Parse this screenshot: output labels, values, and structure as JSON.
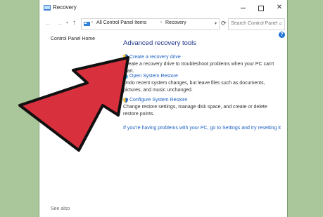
{
  "window": {
    "title": "Recovery",
    "min_label": "",
    "close_label": "✕"
  },
  "address_bar": {
    "crumbs": [
      "All Control Panel Items",
      "Recovery"
    ],
    "separator": "›"
  },
  "search": {
    "placeholder": "Search Control Panel"
  },
  "sidebar": {
    "home_link": "Control Panel Home",
    "see_also": "See also"
  },
  "main": {
    "heading": "Advanced recovery tools",
    "tasks": [
      {
        "label": "Create a recovery drive",
        "description": "Create a recovery drive to troubleshoot problems when your PC can't start."
      },
      {
        "label": "Open System Restore",
        "description": "Undo recent system changes, but leave files such as documents, pictures, and music unchanged."
      },
      {
        "label": "Configure System Restore",
        "description": "Change restore settings, manage disk space, and create or delete restore points."
      }
    ],
    "reset_link": "If you're having problems with your PC, go to Settings and try resetting it"
  },
  "colors": {
    "background": "#a9c79a",
    "link": "#1a5fc0",
    "heading": "#1e3287",
    "arrow": "#d9303e"
  },
  "icons": [
    "recovery-window-icon",
    "back-arrow-icon",
    "forward-arrow-icon",
    "up-arrow-icon",
    "control-panel-icon",
    "refresh-icon",
    "search-icon",
    "help-icon",
    "shield-icon",
    "pointer-arrow-icon"
  ]
}
